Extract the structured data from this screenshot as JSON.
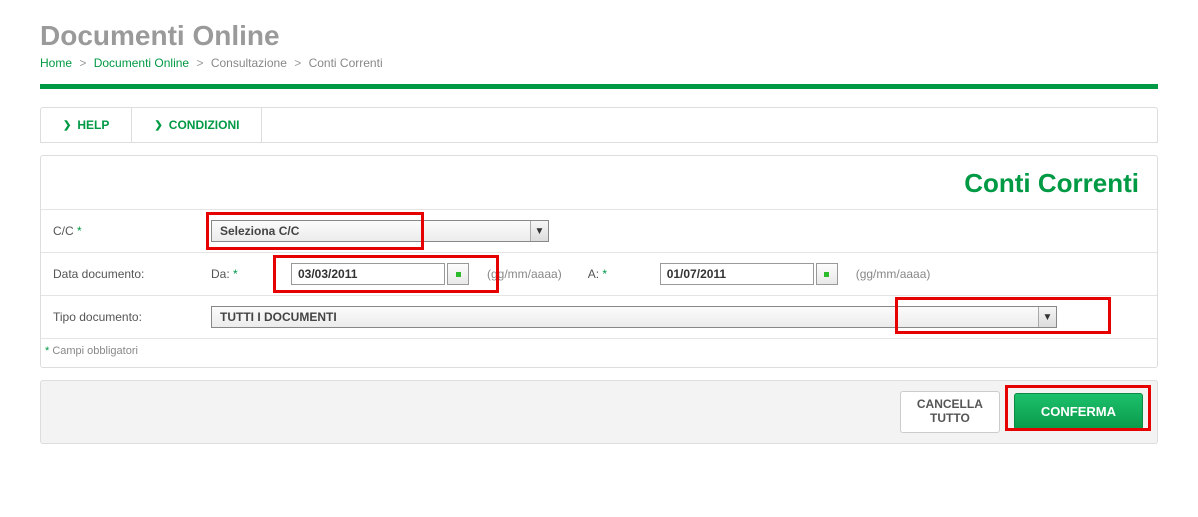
{
  "header": {
    "title": "Documenti Online"
  },
  "breadcrumb": {
    "home": "Home",
    "docs": "Documenti Online",
    "consult": "Consultazione",
    "cc": "Conti Correnti"
  },
  "tabs": {
    "help": "HELP",
    "cond": "CONDIZIONI"
  },
  "panel": {
    "title": "Conti Correnti"
  },
  "form": {
    "cc_label": "C/C",
    "cc_placeholder": "Seleziona C/C",
    "data_doc_label": "Data documento:",
    "from_label": "Da:",
    "from_value": "03/03/2011",
    "to_label": "A:",
    "to_value": "01/07/2011",
    "date_hint": "(gg/mm/aaaa)",
    "tipo_label": "Tipo documento:",
    "tipo_value": "TUTTI I DOCUMENTI",
    "req_marker": "*",
    "required_note_star": "*",
    "required_note_text": " Campi obbligatori"
  },
  "actions": {
    "cancel": "CANCELLA TUTTO",
    "confirm": "CONFERMA"
  }
}
